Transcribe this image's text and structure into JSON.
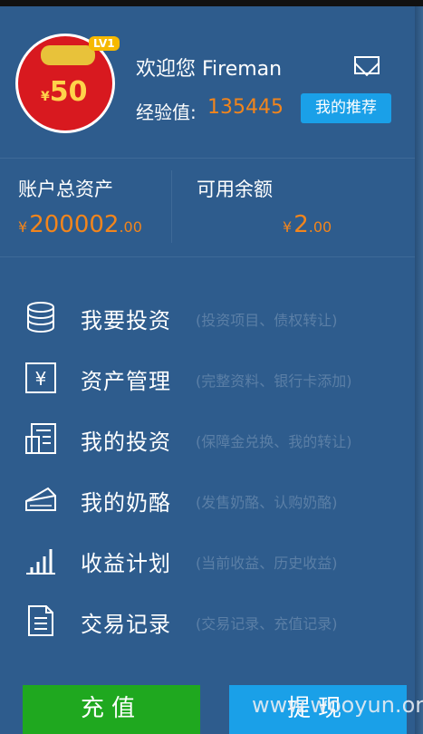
{
  "profile": {
    "level": "LV1",
    "avatar_text": "50",
    "avatar_currency": "¥",
    "welcome": "欢迎您 Fireman",
    "exp_label": "经验值:",
    "exp_value": "135445",
    "recommend_button": "我的推荐"
  },
  "assets": {
    "total_label": "账户总资产",
    "total_currency": "¥",
    "total_int": "200002",
    "total_dec": ".00",
    "available_label": "可用余额",
    "available_currency": "¥",
    "available_int": "2",
    "available_dec": ".00"
  },
  "menu": [
    {
      "icon": "database-icon",
      "title": "我要投资",
      "sub": "(投资项目、债权转让)"
    },
    {
      "icon": "yen-document-icon",
      "title": "资产管理",
      "sub": "(完整资料、银行卡添加)"
    },
    {
      "icon": "documents-icon",
      "title": "我的投资",
      "sub": "(保障金兑换、我的转让)"
    },
    {
      "icon": "cheese-icon",
      "title": "我的奶酪",
      "sub": "(发售奶酪、认购奶酪)"
    },
    {
      "icon": "bar-chart-icon",
      "title": "收益计划",
      "sub": "(当前收益、历史收益)"
    },
    {
      "icon": "record-list-icon",
      "title": "交易记录",
      "sub": "(交易记录、充值记录)"
    }
  ],
  "actions": {
    "charge": "充值",
    "withdraw": "提现"
  },
  "watermark": "www.wooyun.org",
  "colors": {
    "background": "#2e5c8d",
    "accent_orange": "#f2851c",
    "blue_button": "#1aa0e8",
    "green_button": "#1fa81f"
  }
}
